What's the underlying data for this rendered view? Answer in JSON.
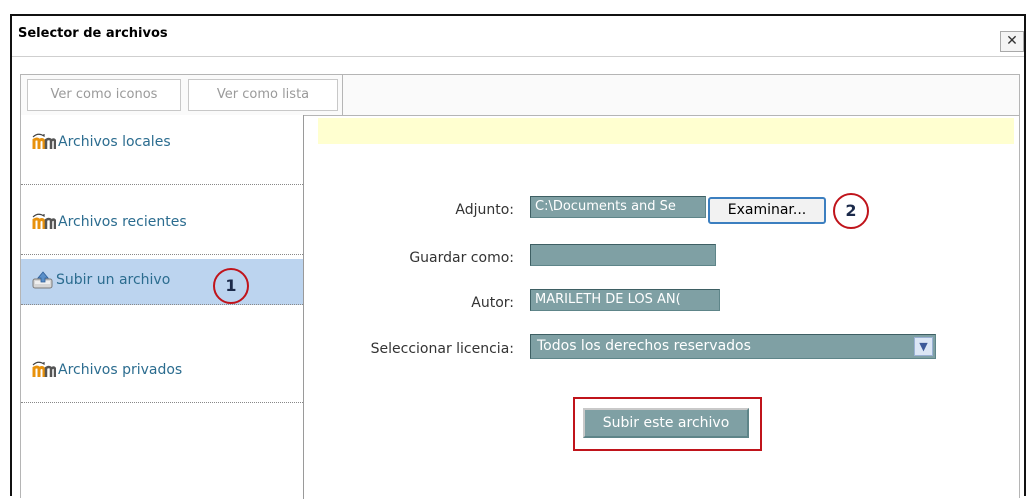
{
  "dialog": {
    "title": "Selector de archivos",
    "close_icon": "✕"
  },
  "toolbar": {
    "view_icons_label": "Ver como iconos",
    "view_list_label": "Ver como lista"
  },
  "sidebar": {
    "items": [
      {
        "label": "Archivos locales",
        "icon": "moodle-icon",
        "active": false
      },
      {
        "label": "Archivos recientes",
        "icon": "moodle-icon",
        "active": false
      },
      {
        "label": "Subir un archivo",
        "icon": "upload-icon",
        "active": true
      },
      {
        "label": "Archivos privados",
        "icon": "moodle-icon",
        "active": false
      }
    ]
  },
  "form": {
    "adjunto_label": "Adjunto:",
    "adjunto_value": "C:\\Documents and Se",
    "examinar_label": "Examinar...",
    "guardar_label": "Guardar como:",
    "guardar_value": "",
    "autor_label": "Autor:",
    "autor_value": "MARILETH DE LOS AN(",
    "licencia_label": "Seleccionar licencia:",
    "licencia_value": "Todos los derechos reservados",
    "submit_label": "Subir este archivo"
  },
  "annotations": {
    "marker1": "1",
    "marker2": "2",
    "highlight_color": "#c0141b"
  },
  "colors": {
    "field_bg": "#7fa0a4",
    "active_item_bg": "#bcd4ef",
    "notice_bg": "#ffffd0",
    "link_color": "#2b6c8f"
  }
}
